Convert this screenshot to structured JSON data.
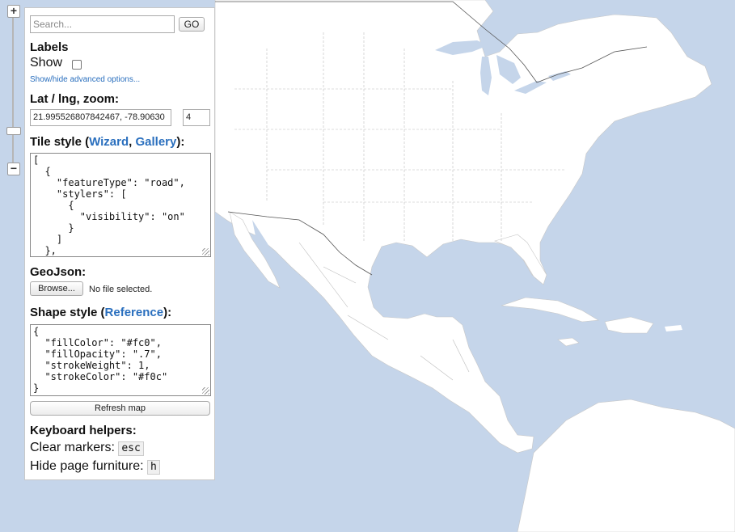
{
  "search": {
    "placeholder": "Search...",
    "go_label": "GO"
  },
  "labels": {
    "heading": "Labels",
    "show_label": "Show",
    "show_checked": false,
    "advanced_link": "Show/hide advanced options..."
  },
  "latlng": {
    "heading": "Lat / lng, zoom:",
    "value": "21.995526807842467, -78.90630",
    "zoom": "4"
  },
  "tile_style": {
    "heading_prefix": "Tile style (",
    "wizard_link": "Wizard",
    "comma": ", ",
    "gallery_link": "Gallery",
    "heading_suffix": "):",
    "lines": [
      "[",
      "  {",
      "    \"featureType\": \"road\",",
      "    \"stylers\": [",
      "      {",
      "        \"visibility\": \"on\"",
      "      }",
      "    ]",
      "  },"
    ]
  },
  "geojson": {
    "heading": "GeoJson:",
    "browse_label": "Browse...",
    "file_status": "No file selected."
  },
  "shape_style": {
    "heading_prefix": "Shape style (",
    "reference_link": "Reference",
    "heading_suffix": "):",
    "lines": [
      "{",
      "  \"fillColor\": \"#fc0\",",
      "  \"fillOpacity\": \".7\",",
      "  \"strokeWeight\": 1,",
      "  \"strokeColor\": \"#f0c\"",
      "}"
    ]
  },
  "refresh_label": "Refresh map",
  "keyboard": {
    "heading": "Keyboard helpers:",
    "clear_label": "Clear markers:",
    "clear_key": "esc",
    "hide_label": "Hide page furniture:",
    "hide_key": "h"
  },
  "zoom_control": {
    "in": "+",
    "out": "−"
  },
  "colors": {
    "water": "#c5d5ea",
    "land": "#ffffff",
    "link": "#2a6fbe",
    "border": "#9a9a9a"
  }
}
